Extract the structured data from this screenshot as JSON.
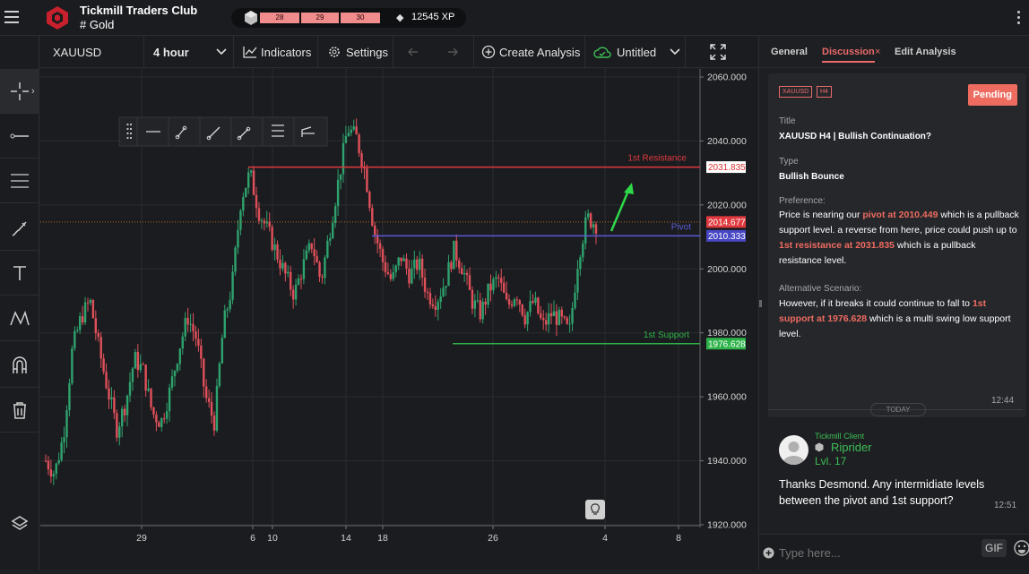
{
  "app": {
    "brand_name": "Tickmill Traders Club",
    "channel": "# Gold",
    "levels": [
      "28",
      "29",
      "30"
    ],
    "xp": "12545 XP"
  },
  "toolbar": {
    "symbol": "XAUUSD",
    "interval": "4 hour",
    "indicators": "Indicators",
    "settings": "Settings",
    "create_analysis": "Create Analysis",
    "layout_name": "Untitled"
  },
  "chart": {
    "price_ticks": [
      "2060.000",
      "2040.000",
      "2020.000",
      "2000.000",
      "1980.000",
      "1960.000",
      "1940.000",
      "1920.000"
    ],
    "date_ticks": [
      "29",
      "6",
      "10",
      "14",
      "18",
      "26",
      "4",
      "8"
    ],
    "resistance_label": "1st Resistance",
    "resistance_value": "2031.835",
    "current_value": "2014.677",
    "pivot_label": "Pivot",
    "pivot_value": "2010.333",
    "support_label": "1st Support",
    "support_value": "1976.628"
  },
  "chart_data": {
    "type": "candlestick",
    "symbol": "XAUUSD",
    "timeframe": "4 hour",
    "ylim": [
      1920,
      2060
    ],
    "x_tick_labels": [
      "29",
      "6",
      "10",
      "14",
      "18",
      "26",
      "4",
      "8"
    ],
    "levels": [
      {
        "name": "1st Resistance",
        "value": 2031.835,
        "color": "#e0393e"
      },
      {
        "name": "Pivot",
        "value": 2010.333,
        "color": "#5b5bd6"
      },
      {
        "name": "1st Support",
        "value": 1976.628,
        "color": "#2eb34a"
      }
    ],
    "last_price": 2014.677,
    "approx_close_path": [
      1940,
      1936,
      1948,
      1975,
      1985,
      1990,
      1975,
      1962,
      1950,
      1958,
      1972,
      1968,
      1955,
      1952,
      1962,
      1975,
      1985,
      1978,
      1960,
      1952,
      1982,
      1995,
      2022,
      2030,
      2018,
      2012,
      2005,
      1998,
      1992,
      2001,
      2008,
      1996,
      2012,
      2028,
      2044,
      2041,
      2030,
      2012,
      2002,
      1996,
      2004,
      1998,
      2002,
      1992,
      1990,
      1996,
      2006,
      2000,
      1990,
      1986,
      1994,
      1997,
      1988,
      1993,
      1985,
      1990,
      1982,
      1986,
      1984,
      1980,
      2004,
      2016,
      2014
    ]
  },
  "panel": {
    "tabs": [
      "General",
      "Discussion",
      "Edit Analysis"
    ],
    "tags": [
      "XAUUSD",
      "H4"
    ],
    "status": "Pending",
    "title_label": "Title",
    "title_value": "XAUUSD H4 | Bullish Continuation?",
    "type_label": "Type",
    "type_value": "Bullish Bounce",
    "preference_label": "Preference:",
    "pref_1": "Price is nearing our ",
    "pref_hl1": "pivot at 2010.449",
    "pref_2": " which is a pullback support level. a reverse from here, price could push up to ",
    "pref_hl2": "1st resistance at 2031.835",
    "pref_3": " which is a pullback resistance level.",
    "alt_label": "Alternative Scenario:",
    "alt_1": "However, if it breaks it could continue to fall to ",
    "alt_hl": "1st support at 1976.628",
    "alt_2": " which is a multi swing low support level.",
    "card_time": "12:44",
    "today": "TODAY",
    "comment_role": "Tickmill Client",
    "comment_user": "Riprider",
    "comment_level": "Lvl. 17",
    "comment_text": "Thanks Desmond. Any intermidiate levels between the pivot and 1st support?",
    "comment_time": "12:51",
    "input_placeholder": "Type here...",
    "gif_label": "GIF"
  },
  "colors": {
    "bull": "#2ea36e",
    "bear": "#e0505a",
    "accent": "#e86a6a"
  }
}
